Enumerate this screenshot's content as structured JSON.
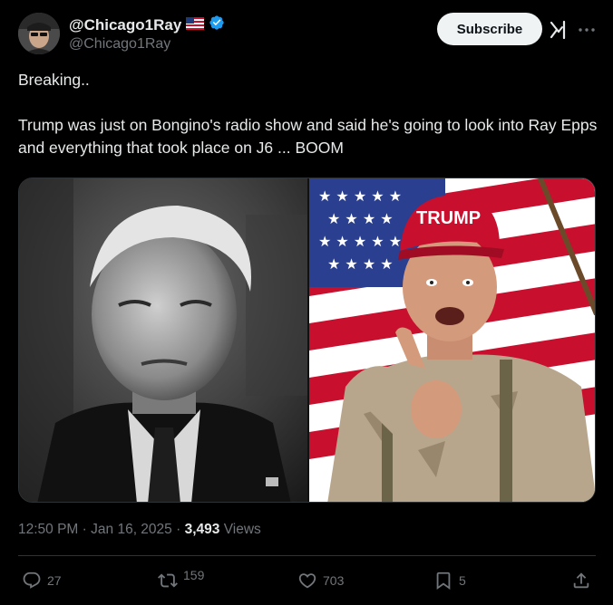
{
  "author": {
    "display_name": "@Chicago1Ray",
    "handle": "@Chicago1Ray",
    "verified": true,
    "flag": "us-flag-icon"
  },
  "header": {
    "subscribe_label": "Subscribe",
    "grok_icon": "grok-icon",
    "more_icon": "more-icon"
  },
  "post": {
    "line1": "Breaking..",
    "line2": "Trump was just on Bongino's radio show and said he's going to look into Ray Epps and everything that took place on J6 ... BOOM"
  },
  "media": {
    "left_image": "black-and-white-portrait-photo",
    "right_image": "man-in-trump-cap-pointing-photo",
    "cap_text": "TRUMP"
  },
  "meta": {
    "time": "12:50 PM",
    "date": "Jan 16, 2025",
    "views_count": "3,493",
    "views_label": "Views",
    "separator": "·"
  },
  "actions": {
    "replies": "27",
    "reposts": "159",
    "likes": "703",
    "bookmarks": "5"
  },
  "colors": {
    "background": "#000000",
    "text": "#e7e9ea",
    "muted": "#71767b",
    "verified": "#1d9bf0",
    "button_bg": "#eff3f4"
  }
}
